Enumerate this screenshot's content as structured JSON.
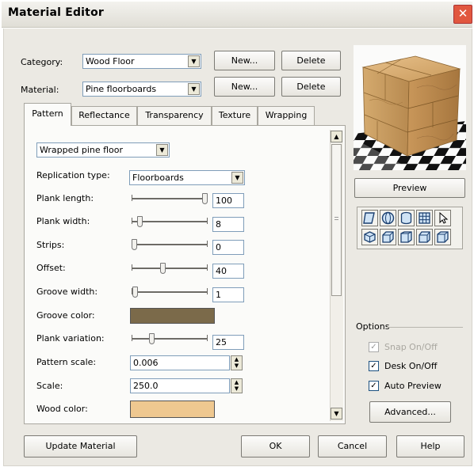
{
  "window": {
    "title": "Material Editor",
    "close_glyph": "✕"
  },
  "header": {
    "category_label": "Category:",
    "category_value": "Wood Floor",
    "material_label": "Material:",
    "material_value": "Pine floorboards",
    "new_label": "New...",
    "delete_label": "Delete"
  },
  "tabs": [
    "Pattern",
    "Reflectance",
    "Transparency",
    "Texture",
    "Wrapping"
  ],
  "pattern": {
    "preset_value": "Wrapped pine floor",
    "replication_label": "Replication type:",
    "replication_value": "Floorboards",
    "plank_length_label": "Plank length:",
    "plank_length_value": "100",
    "plank_width_label": "Plank width:",
    "plank_width_value": "8",
    "strips_label": "Strips:",
    "strips_value": "0",
    "offset_label": "Offset:",
    "offset_value": "40",
    "groove_width_label": "Groove width:",
    "groove_width_value": "1",
    "groove_color_label": "Groove color:",
    "groove_color": "#7b6a4a",
    "plank_variation_label": "Plank variation:",
    "plank_variation_value": "25",
    "pattern_scale_label": "Pattern scale:",
    "pattern_scale_value": "0.006",
    "scale_label": "Scale:",
    "scale_value": "250.0",
    "wood_color_label": "Wood color:",
    "wood_color": "#efc890"
  },
  "sliders": {
    "plank_length": 1.0,
    "plank_width": 0.08,
    "strips": 0.0,
    "offset": 0.4,
    "groove_width": 0.01,
    "plank_variation": 0.25
  },
  "preview": {
    "button_label": "Preview",
    "icons_row1": [
      "plane-shape-icon",
      "sphere-shape-icon",
      "cylinder-shape-icon",
      "grid-shape-icon",
      "pointer-icon"
    ],
    "icons_row2": [
      "cube-view-1-icon",
      "cube-view-2-icon",
      "cube-view-3-icon",
      "cube-view-4-icon",
      "cube-view-5-icon"
    ]
  },
  "options": {
    "heading": "Options",
    "snap_label": "Snap On/Off",
    "desk_label": "Desk On/Off",
    "auto_preview_label": "Auto Preview",
    "advanced_label": "Advanced...",
    "check_glyph": "✓"
  },
  "footer": {
    "update_label": "Update Material",
    "ok_label": "OK",
    "cancel_label": "Cancel",
    "help_label": "Help"
  },
  "colors": {
    "accent_close": "#e1573f",
    "dialog_bg": "#ebe9e3"
  },
  "glyphs": {
    "arrow_down": "▼",
    "arrow_up": "▲",
    "spin_up": "▲",
    "spin_down": "▼"
  }
}
